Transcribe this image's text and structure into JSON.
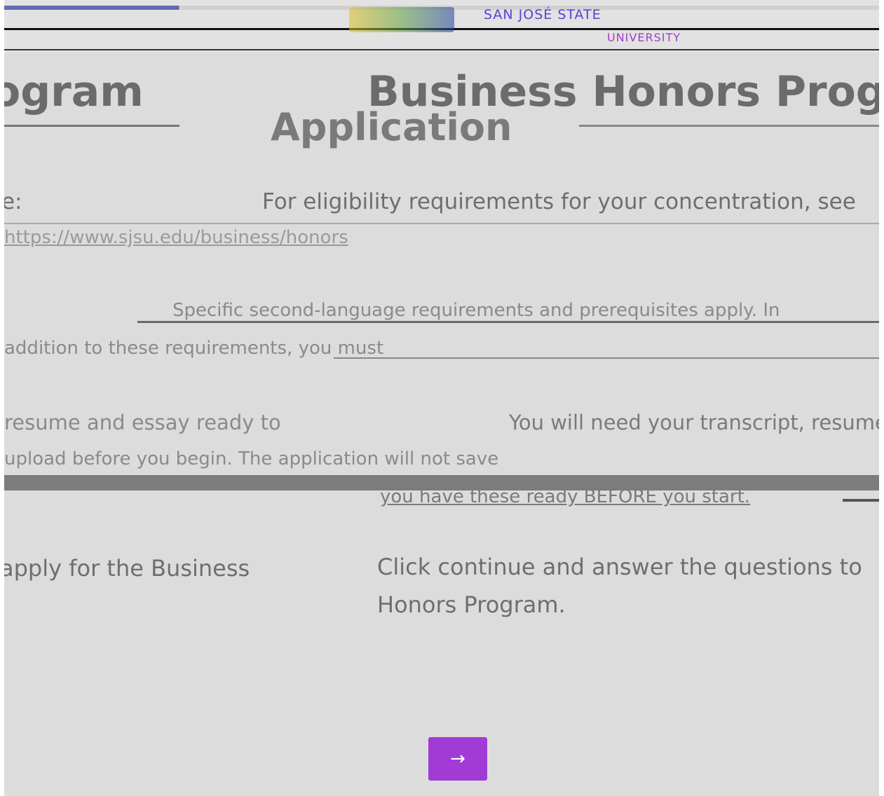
{
  "header": {
    "university_line1": "SAN JOSÉ STATE",
    "university_line2": "UNIVERSITY"
  },
  "page": {
    "title": "Business Honors Program",
    "title_fragment": "ogram",
    "subtitle": "Application"
  },
  "body": {
    "eligibility_text": "For eligibility requirements for your concentration, see",
    "eligibility_fragment": "e:",
    "link_text": "https://www.sjsu.edu/business/honors",
    "requirements_line1": "Specific second-language requirements and prerequisites apply. In",
    "requirements_line2": "addition to these requirements, you must",
    "documents_text": "You will need your transcript, resume and essay ready to",
    "documents_fragment": "resume and essay ready to",
    "documents_line2": "upload before you begin. The application will not save",
    "documents_line3": "you have these ready BEFORE you start.",
    "continue_instruction": "Click continue and answer the questions to",
    "continue_fragment": "apply for the Business",
    "continue_instruction_line2": "Honors Program."
  },
  "actions": {
    "continue_icon": "right-arrow-icon",
    "continue_glyph": "→"
  },
  "colors": {
    "accent": "#a23ad6",
    "background": "#dcdcdc",
    "text": "#6e6e6e"
  }
}
